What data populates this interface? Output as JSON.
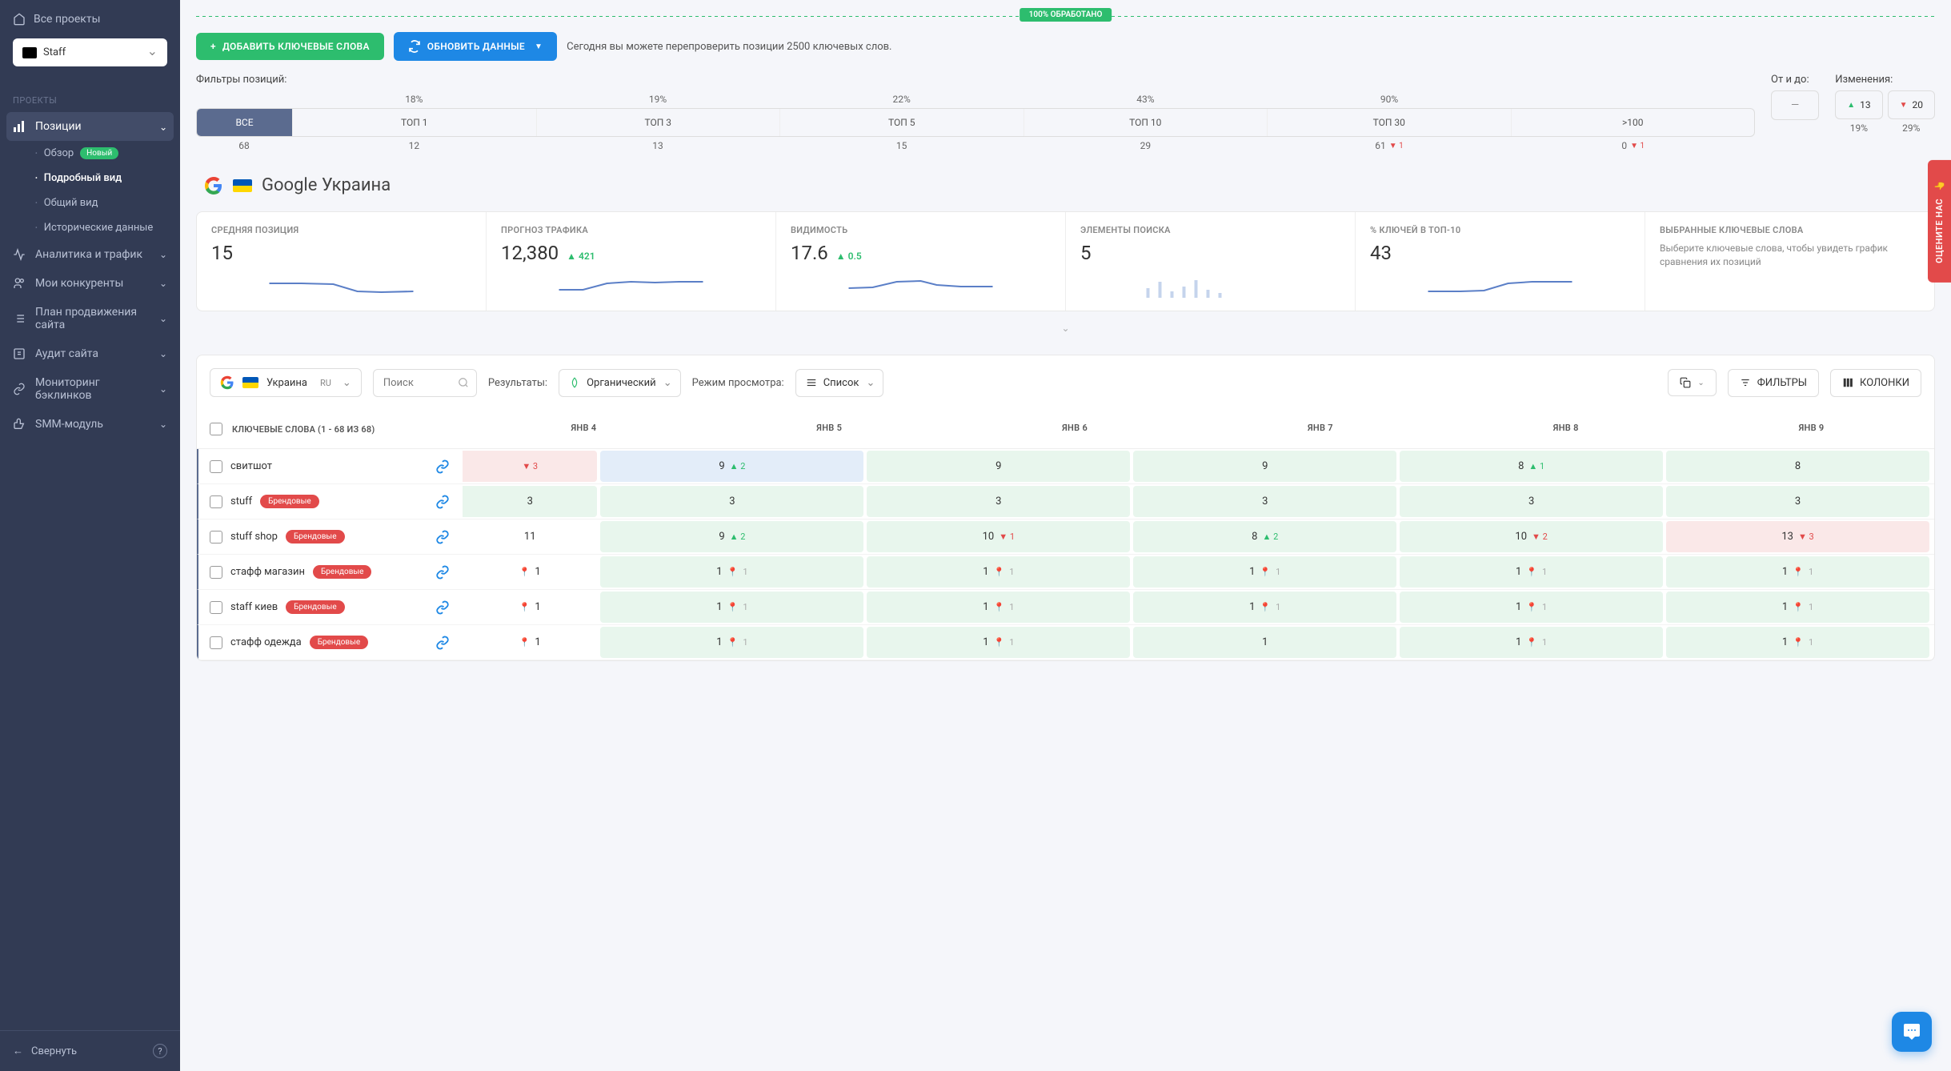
{
  "sidebar": {
    "all_projects": "Все проекты",
    "project_name": "Staff",
    "section_label": "ПРОЕКТЫ",
    "nav": {
      "positions": "Позиции",
      "overview": "Обзор",
      "overview_badge": "Новый",
      "detailed": "Подробный вид",
      "general": "Общий вид",
      "historical": "Исторические данные",
      "analytics": "Аналитика и трафик",
      "competitors": "Мои конкуренты",
      "plan": "План продвижения сайта",
      "audit": "Аудит сайта",
      "backlinks": "Мониторинг бэклинков",
      "smm": "SMM-модуль"
    },
    "collapse": "Свернуть"
  },
  "status": "100% ОБРАБОТАНО",
  "toolbar": {
    "add": "ДОБАВИТЬ КЛЮЧЕВЫЕ СЛОВА",
    "refresh": "ОБНОВИТЬ ДАННЫЕ",
    "note": "Сегодня вы можете перепроверить позиции 2500 ключевых слов."
  },
  "filters": {
    "label": "Фильтры позиций:",
    "tabs": [
      {
        "label": "ВСЕ",
        "pct": "",
        "count": "68",
        "active": true
      },
      {
        "label": "ТОП 1",
        "pct": "18%",
        "count": "12"
      },
      {
        "label": "ТОП 3",
        "pct": "19%",
        "count": "13"
      },
      {
        "label": "ТОП 5",
        "pct": "22%",
        "count": "15"
      },
      {
        "label": "ТОП 10",
        "pct": "43%",
        "count": "29"
      },
      {
        "label": "ТОП 30",
        "pct": "90%",
        "count": "61",
        "delta": "1",
        "dir": "down"
      },
      {
        "label": ">100",
        "pct": "",
        "count": "0",
        "delta": "1",
        "dir": "down"
      }
    ],
    "range_label": "От и до:",
    "range_value": "—",
    "changes_label": "Изменения:",
    "up": "13",
    "down": "20",
    "up_pct": "19%",
    "down_pct": "29%"
  },
  "search_engine": "Google Украина",
  "stats": [
    {
      "label": "СРЕДНЯЯ ПОЗИЦИЯ",
      "value": "15"
    },
    {
      "label": "ПРОГНОЗ ТРАФИКА",
      "value": "12,380",
      "delta": "421",
      "dir": "up"
    },
    {
      "label": "ВИДИМОСТЬ",
      "value": "17.6",
      "delta": "0.5",
      "dir": "up"
    },
    {
      "label": "ЭЛЕМЕНТЫ ПОИСКА",
      "value": "5"
    },
    {
      "label": "% КЛЮЧЕЙ В ТОП-10",
      "value": "43"
    },
    {
      "label": "ВЫБРАННЫЕ КЛЮЧЕВЫЕ СЛОВА",
      "desc": "Выберите ключевые слова, чтобы увидеть график сравнения их позиций"
    }
  ],
  "table_toolbar": {
    "country": "Украина",
    "lang": "RU",
    "search_placeholder": "Поиск",
    "results_label": "Результаты:",
    "results_value": "Органический",
    "view_label": "Режим просмотра:",
    "view_value": "Список",
    "filters_btn": "ФИЛЬТРЫ",
    "columns_btn": "КОЛОНКИ"
  },
  "table": {
    "kw_header": "КЛЮЧЕВЫЕ СЛОВА (1 - 68 ИЗ 68)",
    "dates": [
      "ЯНВ 4",
      "ЯНВ 5",
      "ЯНВ 6",
      "ЯНВ 7",
      "ЯНВ 8",
      "ЯНВ 9"
    ],
    "rows": [
      {
        "kw": "свитшот",
        "brand": false,
        "cells": [
          {
            "v": "",
            "d": "3",
            "dir": "down",
            "c": "red",
            "partial": true
          },
          {
            "v": "9",
            "d": "2",
            "dir": "up",
            "c": "blue"
          },
          {
            "v": "9",
            "c": "green"
          },
          {
            "v": "9",
            "c": "green"
          },
          {
            "v": "8",
            "d": "1",
            "dir": "up",
            "c": "green"
          },
          {
            "v": "8",
            "c": "green"
          }
        ]
      },
      {
        "kw": "stuff",
        "brand": true,
        "cells": [
          {
            "v": "3",
            "c": "green",
            "partial": true
          },
          {
            "v": "3",
            "c": "green"
          },
          {
            "v": "3",
            "c": "green"
          },
          {
            "v": "3",
            "c": "green"
          },
          {
            "v": "3",
            "c": "green"
          },
          {
            "v": "3",
            "c": "green"
          }
        ]
      },
      {
        "kw": "stuff shop",
        "brand": true,
        "cells": [
          {
            "v": "11",
            "partial": true
          },
          {
            "v": "9",
            "d": "2",
            "dir": "up",
            "c": "green"
          },
          {
            "v": "10",
            "d": "1",
            "dir": "down",
            "c": "green"
          },
          {
            "v": "8",
            "d": "2",
            "dir": "up",
            "c": "green"
          },
          {
            "v": "10",
            "d": "2",
            "dir": "down",
            "c": "green"
          },
          {
            "v": "13",
            "d": "3",
            "dir": "down",
            "c": "red"
          }
        ]
      },
      {
        "kw": "стафф магазин",
        "brand": true,
        "cells": [
          {
            "v": "",
            "pin": "1",
            "partial": true
          },
          {
            "v": "1",
            "pin": "1",
            "c": "green"
          },
          {
            "v": "1",
            "pin": "1",
            "c": "green"
          },
          {
            "v": "1",
            "pin": "1",
            "c": "green"
          },
          {
            "v": "1",
            "pin": "1",
            "c": "green"
          },
          {
            "v": "1",
            "pin": "1",
            "c": "green"
          }
        ]
      },
      {
        "kw": "staff киев",
        "brand": true,
        "cells": [
          {
            "v": "",
            "pin": "1",
            "partial": true
          },
          {
            "v": "1",
            "pin": "1",
            "c": "green"
          },
          {
            "v": "1",
            "pin": "1",
            "c": "green"
          },
          {
            "v": "1",
            "pin": "1",
            "c": "green"
          },
          {
            "v": "1",
            "pin": "1",
            "c": "green"
          },
          {
            "v": "1",
            "pin": "1",
            "c": "green"
          }
        ]
      },
      {
        "kw": "стафф одежда",
        "brand": true,
        "cells": [
          {
            "v": "",
            "pin": "1",
            "partial": true
          },
          {
            "v": "1",
            "pin": "1",
            "c": "green"
          },
          {
            "v": "1",
            "pin": "1",
            "c": "green"
          },
          {
            "v": "1",
            "c": "green"
          },
          {
            "v": "1",
            "pin": "1",
            "c": "green"
          },
          {
            "v": "1",
            "pin": "1",
            "c": "green"
          }
        ]
      }
    ]
  },
  "brand_tag": "Брендовые",
  "feedback": "ОЦЕНИТЕ НАС"
}
